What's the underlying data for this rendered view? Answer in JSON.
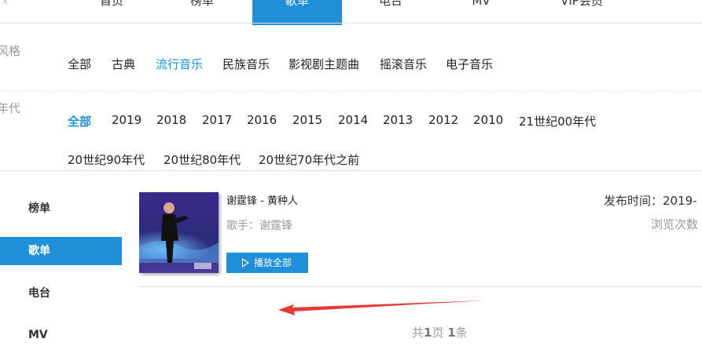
{
  "nav": {
    "items": [
      {
        "label": "首页",
        "active": false
      },
      {
        "label": "榜单",
        "active": false
      },
      {
        "label": "歌单",
        "active": true
      },
      {
        "label": "电台",
        "active": false
      },
      {
        "label": "MV",
        "active": false
      },
      {
        "label": "VIP会员",
        "active": false
      }
    ]
  },
  "filters": {
    "style": {
      "label": "风格",
      "options": [
        "全部",
        "古典",
        "流行音乐",
        "民族音乐",
        "影视剧主题曲",
        "摇滚音乐",
        "电子音乐"
      ],
      "selected": "流行音乐"
    },
    "era": {
      "label": "年代",
      "options": [
        "全部",
        "2019",
        "2018",
        "2017",
        "2016",
        "2015",
        "2014",
        "2013",
        "2012",
        "2010",
        "21世纪00年代",
        "20世纪90年代",
        "20世纪80年代",
        "20世纪70年代之前"
      ],
      "selected": "全部"
    }
  },
  "sidebar": {
    "items": [
      {
        "label": "榜单",
        "active": false
      },
      {
        "label": "歌单",
        "active": true
      },
      {
        "label": "电台",
        "active": false
      },
      {
        "label": "MV",
        "active": false
      }
    ]
  },
  "playlist": {
    "title": "谢霆锋 - 黄种人",
    "artist": "歌手：谢霆锋",
    "play_all_label": "播放全部",
    "release": "发布时间：2019-",
    "views": "浏览次数"
  },
  "pagination": {
    "prefix": "共",
    "pages": "1",
    "pages_unit": "页 ",
    "count": "1",
    "count_unit": "条"
  },
  "colors": {
    "accent": "#1e8fd8",
    "annotation_arrow": "#e53935"
  }
}
